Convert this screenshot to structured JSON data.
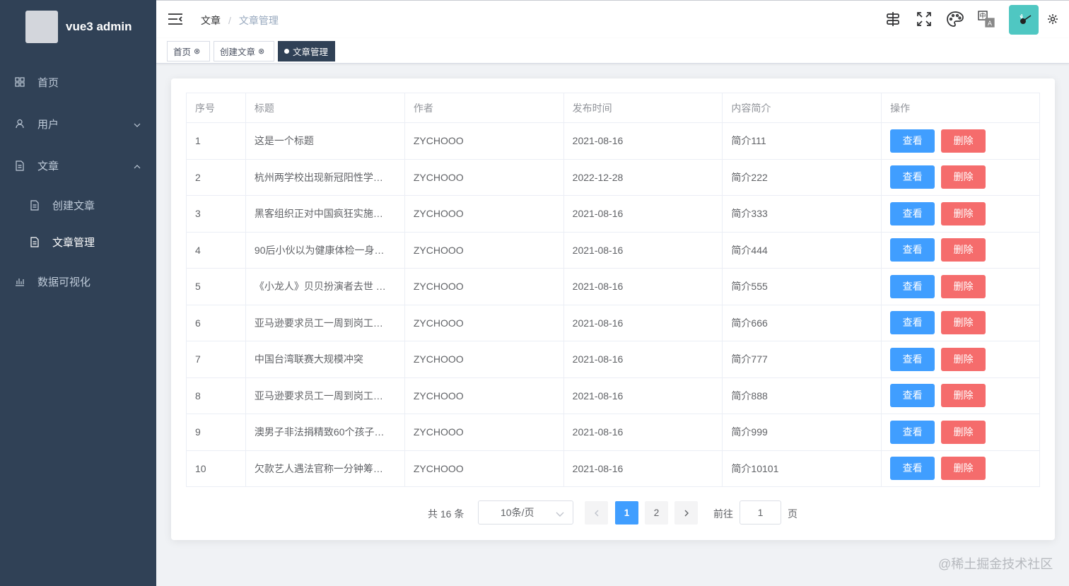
{
  "sidebar": {
    "logo_text": "vue3 admin",
    "items": [
      {
        "label": "首页",
        "icon": "grid-icon"
      },
      {
        "label": "用户",
        "icon": "user-icon"
      },
      {
        "label": "文章",
        "icon": "document-icon"
      },
      {
        "label": "创建文章",
        "icon": "document-icon"
      },
      {
        "label": "文章管理",
        "icon": "document-icon"
      },
      {
        "label": "数据可视化",
        "icon": "chart-icon"
      }
    ]
  },
  "header": {
    "breadcrumb": [
      "文章",
      "/",
      "文章管理"
    ],
    "icons": [
      "search-menu-icon",
      "fullscreen-icon",
      "theme-palette-icon",
      "language-icon",
      "user-avatar",
      "settings-icon"
    ]
  },
  "tags": [
    {
      "label": "首页",
      "close": "⊗"
    },
    {
      "label": "创建文章",
      "close": "⊗"
    },
    {
      "label": "文章管理"
    }
  ],
  "table": {
    "columns": [
      "序号",
      "标题",
      "作者",
      "发布时间",
      "内容简介",
      "操作"
    ],
    "view_label": "查看",
    "delete_label": "删除",
    "rows": [
      {
        "id": "1",
        "title": "这是一个标题",
        "author": "ZYCHOOO",
        "date": "2021-08-16",
        "summary": "简介111"
      },
      {
        "id": "2",
        "title": "杭州两学校出现新冠阳性学…",
        "author": "ZYCHOOO",
        "date": "2022-12-28",
        "summary": "简介222"
      },
      {
        "id": "3",
        "title": "黑客组织正对中国疯狂实施…",
        "author": "ZYCHOOO",
        "date": "2021-08-16",
        "summary": "简介333"
      },
      {
        "id": "4",
        "title": "90后小伙以为健康体检一身…",
        "author": "ZYCHOOO",
        "date": "2021-08-16",
        "summary": "简介444"
      },
      {
        "id": "5",
        "title": "《小龙人》贝贝扮演者去世 …",
        "author": "ZYCHOOO",
        "date": "2021-08-16",
        "summary": "简介555"
      },
      {
        "id": "6",
        "title": "亚马逊要求员工一周到岗工…",
        "author": "ZYCHOOO",
        "date": "2021-08-16",
        "summary": "简介666"
      },
      {
        "id": "7",
        "title": "中国台湾联赛大规模冲突",
        "author": "ZYCHOOO",
        "date": "2021-08-16",
        "summary": "简介777"
      },
      {
        "id": "8",
        "title": "亚马逊要求员工一周到岗工…",
        "author": "ZYCHOOO",
        "date": "2021-08-16",
        "summary": "简介888"
      },
      {
        "id": "9",
        "title": "澳男子非法捐精致60个孩子…",
        "author": "ZYCHOOO",
        "date": "2021-08-16",
        "summary": "简介999"
      },
      {
        "id": "10",
        "title": "欠款艺人遇法官称一分钟筹…",
        "author": "ZYCHOOO",
        "date": "2021-08-16",
        "summary": "简介10101"
      }
    ]
  },
  "pagination": {
    "total_text": "共 16 条",
    "page_size": "10条/页",
    "pages": [
      "1",
      "2"
    ],
    "current_page": "1",
    "goto_label": "前往",
    "goto_value": "1",
    "page_suffix": "页"
  },
  "watermark": "@稀土掘金技术社区",
  "colors": {
    "sidebar_bg": "#304156",
    "primary": "#409eff",
    "danger": "#f56c6c",
    "avatar_bg": "#4fc7c2"
  }
}
